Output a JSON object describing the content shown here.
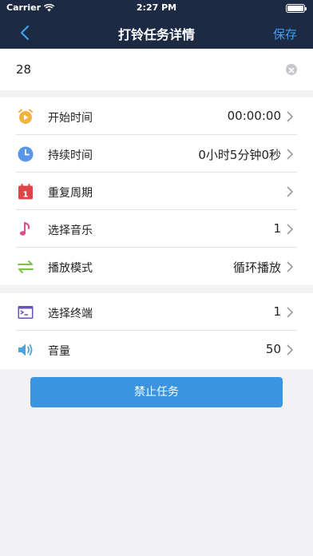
{
  "status_bar": {
    "carrier": "Carrier",
    "time": "2:27 PM"
  },
  "nav": {
    "title": "打铃任务详情",
    "save_label": "保存"
  },
  "task_name": {
    "value": "28"
  },
  "group1": [
    {
      "label": "开始时间",
      "value": "00:00:00",
      "icon": "alarm-clock-icon"
    },
    {
      "label": "持续时间",
      "value": "0小时5分钟0秒",
      "icon": "clock-icon"
    },
    {
      "label": "重复周期",
      "value": "",
      "icon": "calendar-icon"
    },
    {
      "label": "选择音乐",
      "value": "1",
      "icon": "music-note-icon"
    },
    {
      "label": "播放模式",
      "value": "循环播放",
      "icon": "swap-arrows-icon"
    }
  ],
  "group2": [
    {
      "label": "选择终端",
      "value": "1",
      "icon": "terminal-icon"
    },
    {
      "label": "音量",
      "value": "50",
      "icon": "speaker-icon"
    }
  ],
  "action": {
    "label": "禁止任务"
  },
  "colors": {
    "nav_bg": "#1c2a43",
    "accent": "#3da0f0",
    "button": "#3a94df"
  }
}
